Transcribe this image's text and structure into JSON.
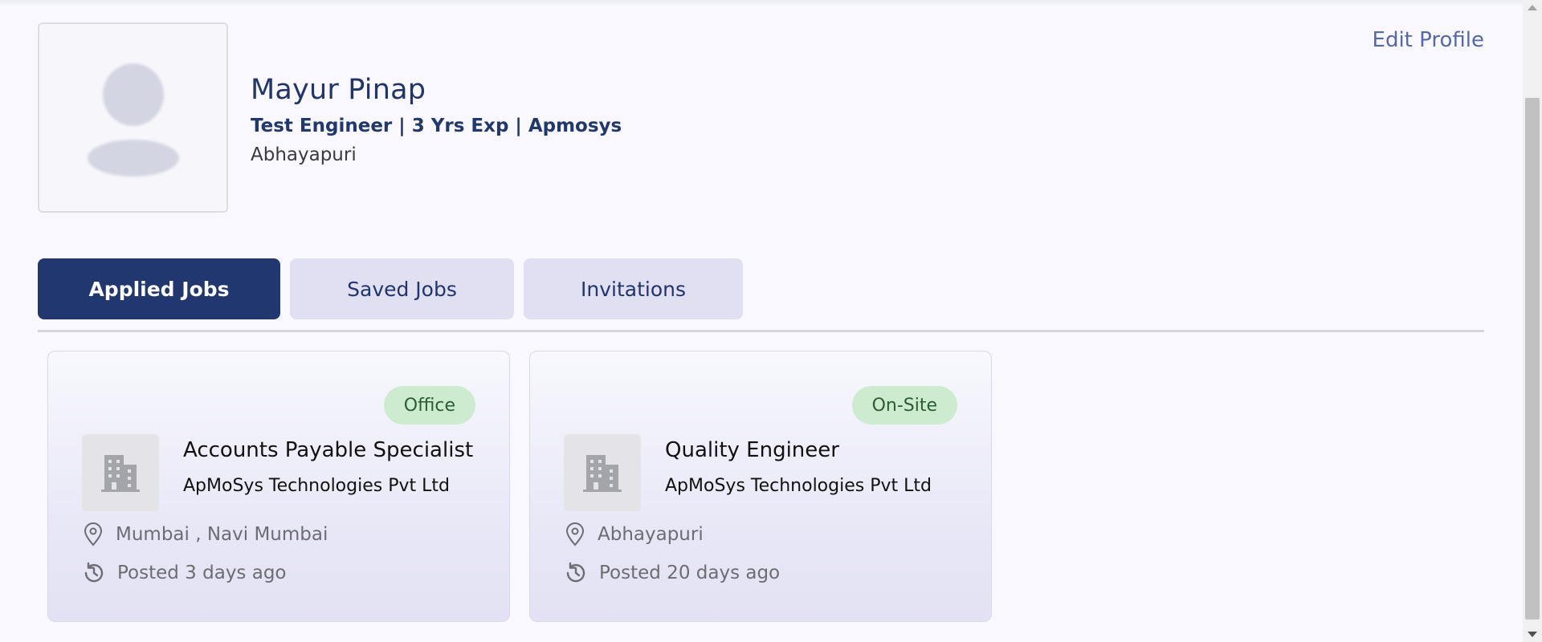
{
  "profile": {
    "name": "Mayur Pinap",
    "subtitle": "Test Engineer | 3 Yrs Exp | Apmosys",
    "location": "Abhayapuri",
    "edit_label": "Edit Profile"
  },
  "tabs": [
    {
      "label": "Applied Jobs",
      "active": true
    },
    {
      "label": "Saved Jobs",
      "active": false
    },
    {
      "label": "Invitations",
      "active": false
    }
  ],
  "jobs": [
    {
      "badge": "Office",
      "title": "Accounts Payable Specialist",
      "company": "ApMoSys Technologies Pvt Ltd",
      "location": "Mumbai , Navi Mumbai",
      "posted": "Posted 3 days ago"
    },
    {
      "badge": "On-Site",
      "title": "Quality Engineer",
      "company": "ApMoSys Technologies Pvt Ltd",
      "location": "Abhayapuri",
      "posted": "Posted 20 days ago"
    }
  ],
  "icons": {
    "avatar": "user-placeholder-icon",
    "company_logo": "building-icon",
    "location": "map-pin-icon",
    "posted": "history-clock-icon"
  },
  "colors": {
    "primary": "#213770",
    "tab_inactive": "#e1e0f3",
    "badge_bg": "#cdeccf",
    "badge_text": "#2d5b36",
    "link": "#5568a8"
  }
}
